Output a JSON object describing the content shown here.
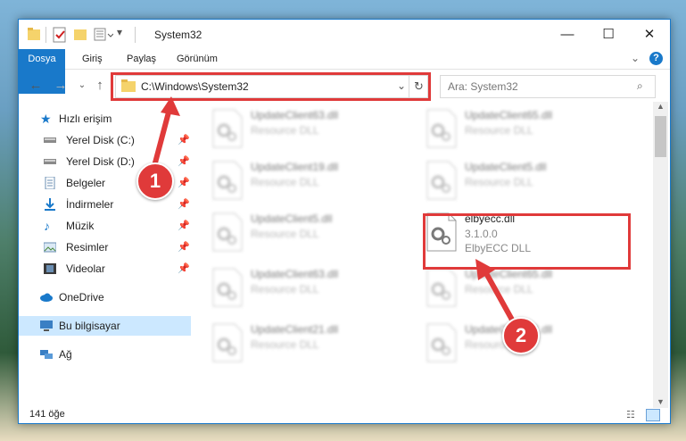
{
  "window": {
    "title": "System32"
  },
  "ribbon": {
    "tabs": [
      "Dosya",
      "Giriş",
      "Paylaş",
      "Görünüm"
    ]
  },
  "address": {
    "path": "C:\\Windows\\System32",
    "search_placeholder": "Ara: System32"
  },
  "sidebar": {
    "quick_access": "Hızlı erişim",
    "items": [
      "Yerel Disk (C:)",
      "Yerel Disk (D:)",
      "Belgeler",
      "İndirmeler",
      "Müzik",
      "Resimler",
      "Videolar"
    ],
    "onedrive": "OneDrive",
    "this_pc": "Bu bilgisayar",
    "network": "Ağ"
  },
  "files": [
    {
      "name": "UpdateClient63.dll",
      "line2": "Resource DLL",
      "line3": ""
    },
    {
      "name": "UpdateClient65.dll",
      "line2": "Resource DLL",
      "line3": ""
    },
    {
      "name": "UpdateClient19.dll",
      "line2": "Resource DLL",
      "line3": ""
    },
    {
      "name": "UpdateClient5.dll",
      "line2": "Resource DLL",
      "line3": ""
    },
    {
      "name": "UpdateClient5.dll",
      "line2": "Resource DLL",
      "line3": ""
    },
    {
      "name": "elbyecc.dll",
      "line2": "3.1.0.0",
      "line3": "ElbyECC DLL"
    },
    {
      "name": "UpdateClient63.dll",
      "line2": "Resource DLL",
      "line3": ""
    },
    {
      "name": "UpdateClient65.dll",
      "line2": "Resource DLL",
      "line3": ""
    },
    {
      "name": "UpdateClient21.dll",
      "line2": "Resource DLL",
      "line3": ""
    },
    {
      "name": "UpdateClient42.dll",
      "line2": "Resource DLL",
      "line3": ""
    }
  ],
  "status": {
    "count": "141 öğe"
  },
  "annotations": {
    "step1": "1",
    "step2": "2"
  },
  "colors": {
    "accent": "#1979ca",
    "callout": "#e03a3a"
  }
}
